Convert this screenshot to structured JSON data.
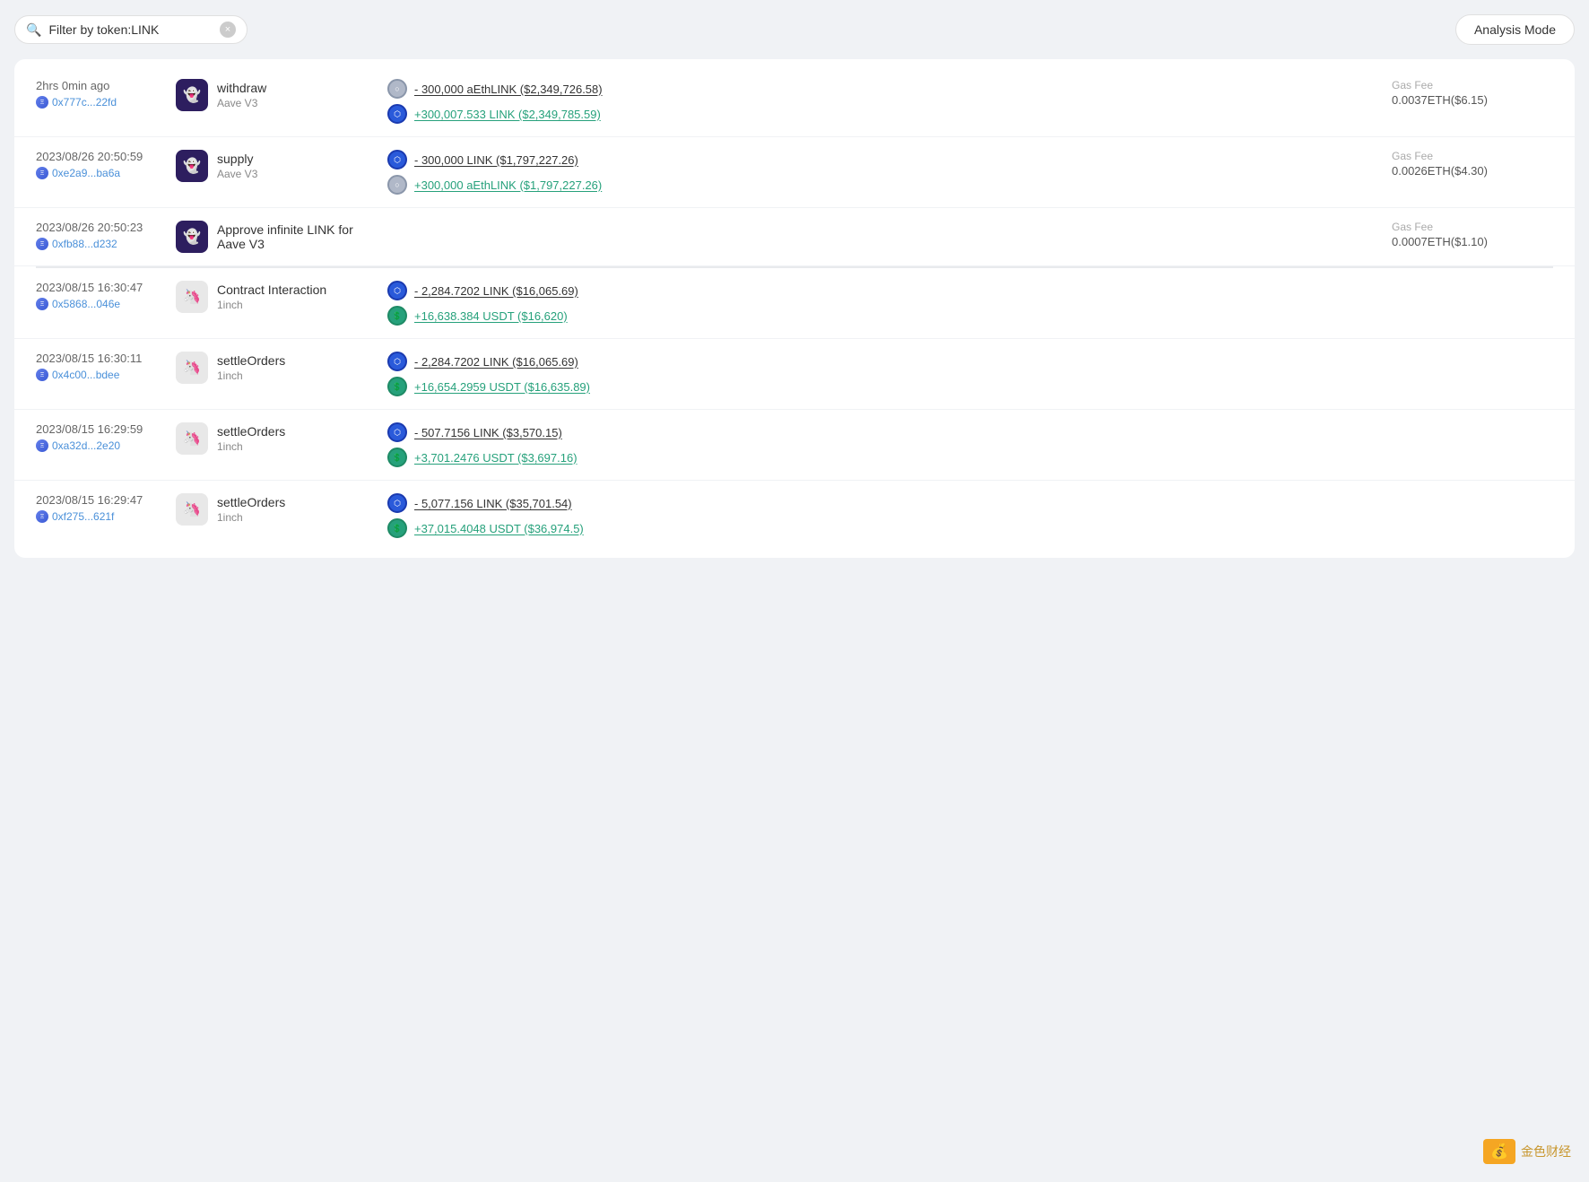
{
  "topBar": {
    "searchPlaceholder": "Filter by token:LINK",
    "searchText": "Filter by token:LINK",
    "clearBtn": "×",
    "analysisBtn": "Analysis Mode"
  },
  "transactions": [
    {
      "id": "tx1",
      "timeAgo": "2hrs 0min ago",
      "hash": "0x777c...22fd",
      "action": "withdraw",
      "protocol": "Aave V3",
      "protocolType": "aave",
      "tokens": [
        {
          "type": "neg",
          "iconType": "link-gray",
          "amount": "- 300,000 aEthLINK ($2,349,726.58)"
        },
        {
          "type": "pos",
          "iconType": "link-blue",
          "amount": "+300,007.533 LINK ($2,349,785.59)"
        }
      ],
      "gasLabel": "Gas Fee",
      "gasValue": "0.0037ETH($6.15)"
    },
    {
      "id": "tx2",
      "time": "2023/08/26 20:50:59",
      "hash": "0xe2a9...ba6a",
      "action": "supply",
      "protocol": "Aave V3",
      "protocolType": "aave",
      "tokens": [
        {
          "type": "neg",
          "iconType": "link-blue",
          "amount": "- 300,000 LINK ($1,797,227.26)"
        },
        {
          "type": "pos",
          "iconType": "link-gray",
          "amount": "+300,000 aEthLINK ($1,797,227.26)"
        }
      ],
      "gasLabel": "Gas Fee",
      "gasValue": "0.0026ETH($4.30)"
    },
    {
      "id": "tx3",
      "time": "2023/08/26 20:50:23",
      "hash": "0xfb88...d232",
      "action": "Approve infinite LINK for Aave V3",
      "protocol": null,
      "protocolType": "aave",
      "tokens": [],
      "gasLabel": "Gas Fee",
      "gasValue": "0.0007ETH($1.10)"
    },
    {
      "id": "tx4",
      "time": "2023/08/15 16:30:47",
      "hash": "0x5868...046e",
      "action": "Contract Interaction",
      "protocol": "1inch",
      "protocolType": "oneinch",
      "tokens": [
        {
          "type": "neg",
          "iconType": "link-blue",
          "amount": "- 2,284.7202 LINK ($16,065.69)"
        },
        {
          "type": "pos",
          "iconType": "usdt-green",
          "amount": "+16,638.384 USDT ($16,620)"
        }
      ],
      "gasLabel": null,
      "gasValue": null
    },
    {
      "id": "tx5",
      "time": "2023/08/15 16:30:11",
      "hash": "0x4c00...bdee",
      "action": "settleOrders",
      "protocol": "1inch",
      "protocolType": "oneinch",
      "tokens": [
        {
          "type": "neg",
          "iconType": "link-blue",
          "amount": "- 2,284.7202 LINK ($16,065.69)"
        },
        {
          "type": "pos",
          "iconType": "usdt-green",
          "amount": "+16,654.2959 USDT ($16,635.89)"
        }
      ],
      "gasLabel": null,
      "gasValue": null
    },
    {
      "id": "tx6",
      "time": "2023/08/15 16:29:59",
      "hash": "0xa32d...2e20",
      "action": "settleOrders",
      "protocol": "1inch",
      "protocolType": "oneinch",
      "tokens": [
        {
          "type": "neg",
          "iconType": "link-blue",
          "amount": "- 507.7156 LINK ($3,570.15)"
        },
        {
          "type": "pos",
          "iconType": "usdt-green",
          "amount": "+3,701.2476 USDT ($3,697.16)"
        }
      ],
      "gasLabel": null,
      "gasValue": null
    },
    {
      "id": "tx7",
      "time": "2023/08/15 16:29:47",
      "hash": "0xf275...621f",
      "action": "settleOrders",
      "protocol": "1inch",
      "protocolType": "oneinch",
      "tokens": [
        {
          "type": "neg",
          "iconType": "link-blue",
          "amount": "- 5,077.156 LINK ($35,701.54)"
        },
        {
          "type": "pos",
          "iconType": "usdt-green",
          "amount": "+37,015.4048 USDT ($36,974.5)"
        }
      ],
      "gasLabel": null,
      "gasValue": null
    }
  ],
  "watermark": {
    "brand": "金色财经"
  }
}
